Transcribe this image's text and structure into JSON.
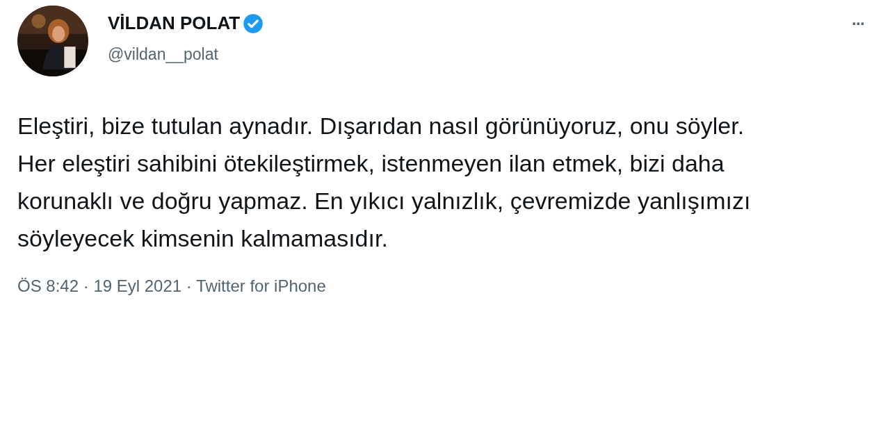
{
  "author": {
    "name": "VİLDAN POLAT",
    "handle": "@vildan__polat",
    "verified": true
  },
  "menu": {
    "label": "···"
  },
  "tweet": {
    "text": "Eleştiri, bize tutulan aynadır. Dışarıdan nasıl görünüyoruz, onu söyler. Her eleştiri sahibini ötekileştirmek, istenmeyen ilan etmek, bizi daha korunaklı ve doğru yapmaz. En yıkıcı yalnızlık, çevremizde yanlışımızı söyleyecek kimsenin kalmamasıdır."
  },
  "meta": "ÖS 8:42 · 19 Eyl 2021 · Twitter for iPhone"
}
